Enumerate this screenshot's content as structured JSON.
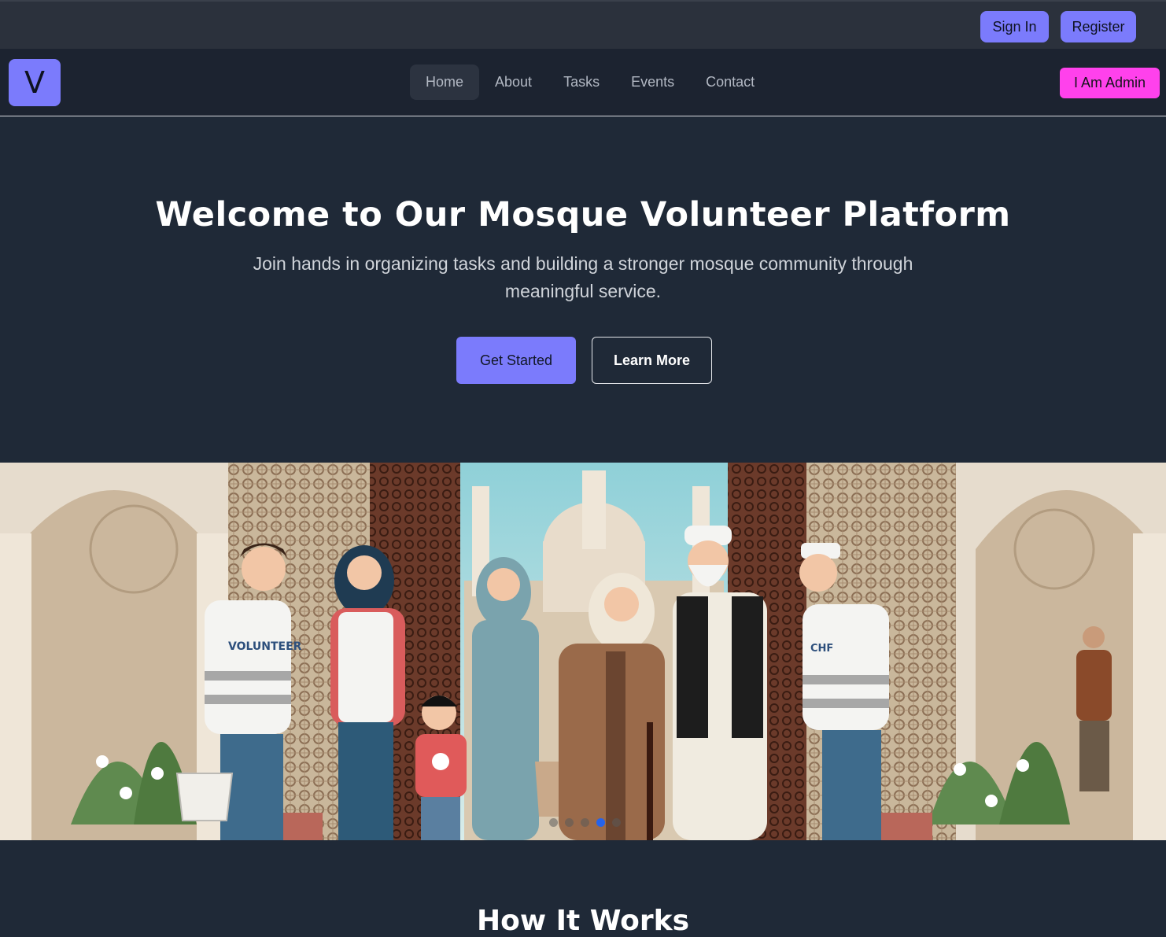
{
  "auth": {
    "sign_in": "Sign In",
    "register": "Register"
  },
  "navbar": {
    "logo_letter": "V",
    "links": [
      "Home",
      "About",
      "Tasks",
      "Events",
      "Contact"
    ],
    "active": "Home",
    "admin_button": "I Am Admin"
  },
  "hero": {
    "title": "Welcome to Our Mosque Volunteer Platform",
    "subtitle": "Join hands in organizing tasks and building a stronger mosque community through meaningful service.",
    "primary_button": "Get Started",
    "secondary_button": "Learn More"
  },
  "carousel": {
    "slide_count": 5,
    "active_index": 3,
    "vest_text_left": "VOLUNTEER",
    "vest_text_right": "CHF"
  },
  "how": {
    "title": "How It Works"
  },
  "colors": {
    "accent": "#7b7bfc",
    "admin": "#ff41ec",
    "background": "#1f2937",
    "active_dot": "#2563eb"
  }
}
